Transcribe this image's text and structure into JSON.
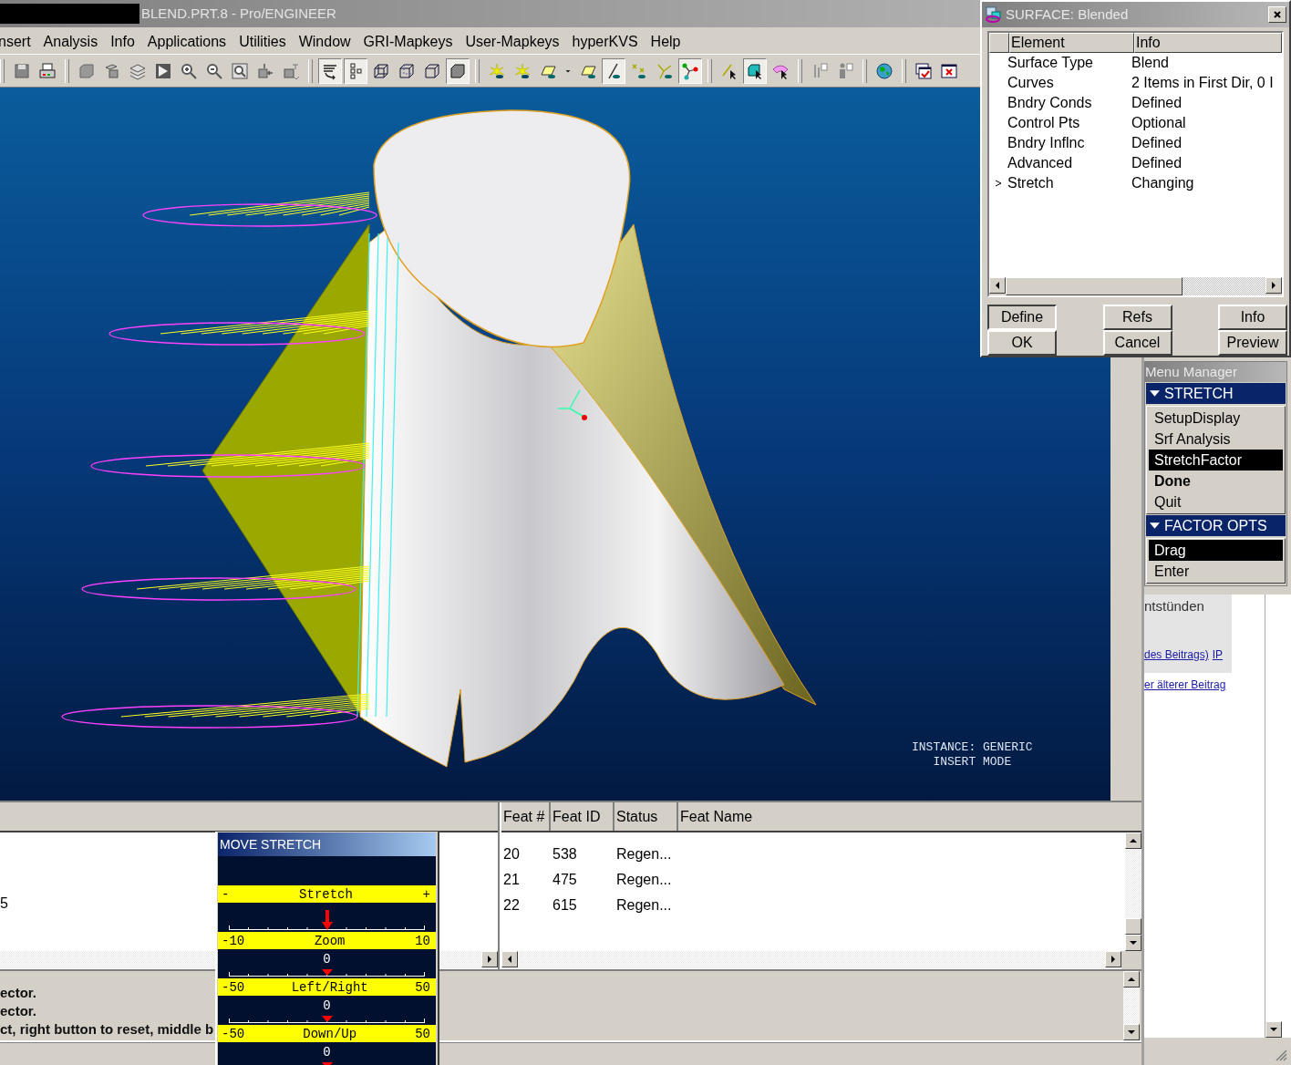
{
  "window": {
    "title": "BLEND.PRT.8 - Pro/ENGINEER"
  },
  "menu_bar": [
    "nsert",
    "Analysis",
    "Info",
    "Applications",
    "Utilities",
    "Window",
    "GRI-Mapkeys",
    "User-Mapkeys",
    "hyperKVS",
    "Help"
  ],
  "toolbar": [
    [
      {
        "kind": "disk",
        "on": false
      },
      {
        "kind": "printer",
        "on": false
      }
    ],
    [
      {
        "kind": "cube",
        "on": false
      },
      {
        "kind": "cubes",
        "on": false
      },
      {
        "kind": "layers",
        "on": false
      },
      {
        "kind": "play",
        "on": false
      },
      {
        "kind": "zoomin",
        "on": false
      },
      {
        "kind": "zoomout",
        "on": false
      },
      {
        "kind": "refit",
        "on": false
      },
      {
        "kind": "orient",
        "on": false
      },
      {
        "kind": "label",
        "on": false
      }
    ],
    [
      {
        "kind": "lines",
        "on": true
      },
      {
        "kind": "tree",
        "on": true
      },
      {
        "kind": "wireframe",
        "on": false
      },
      {
        "kind": "hidden",
        "on": false
      },
      {
        "kind": "outline",
        "on": false
      },
      {
        "kind": "shaded",
        "on": true
      }
    ],
    [
      {
        "kind": "spark",
        "on": false
      },
      {
        "kind": "spark",
        "on": false
      },
      {
        "kind": "plane",
        "on": false
      },
      {
        "kind": "caret",
        "on": false
      },
      {
        "kind": "plane",
        "on": false
      },
      {
        "kind": "axis",
        "on": true
      },
      {
        "kind": "points",
        "on": false
      },
      {
        "kind": "csys",
        "on": false
      },
      {
        "kind": "nodes",
        "on": true
      }
    ],
    [
      {
        "kind": "pick",
        "on": false
      },
      {
        "kind": "boxpick",
        "on": true
      },
      {
        "kind": "surfpick",
        "on": false
      }
    ],
    [
      {
        "kind": "measure",
        "on": false
      },
      {
        "kind": "person",
        "on": false
      }
    ],
    [
      {
        "kind": "globe",
        "on": false
      }
    ],
    [
      {
        "kind": "wincheck",
        "on": false
      },
      {
        "kind": "winclose",
        "on": false
      }
    ]
  ],
  "viewport": {
    "status_lines": [
      "INSTANCE: GENERIC",
      "INSERT MODE"
    ]
  },
  "left_panel": {
    "items": [
      "5"
    ]
  },
  "model_tree": {
    "columns": [
      "Feat #",
      "Feat ID",
      "Status",
      "Feat Name"
    ],
    "rows": [
      [
        "20",
        "538",
        "Regen..."
      ],
      [
        "21",
        "475",
        "Regen..."
      ],
      [
        "22",
        "615",
        "Regen..."
      ]
    ]
  },
  "messages": [
    "ector.",
    "ector.",
    "ct, right button to reset, middle b"
  ],
  "surface_dialog": {
    "title": "SURFACE: Blended",
    "columns": [
      "Element",
      "Info"
    ],
    "rows": [
      {
        "element": "Surface Type",
        "info": "Blend",
        "selected": false
      },
      {
        "element": "Curves",
        "info": "2 Items in First Dir, 0 I",
        "selected": false
      },
      {
        "element": "Bndry Conds",
        "info": "Defined",
        "selected": false
      },
      {
        "element": "Control Pts",
        "info": "Optional",
        "selected": false
      },
      {
        "element": "Bndry Inflnc",
        "info": "Defined",
        "selected": false
      },
      {
        "element": "Advanced",
        "info": "Defined",
        "selected": false
      },
      {
        "element": "Stretch",
        "info": "Changing",
        "selected": true
      }
    ],
    "buttons": [
      "Define",
      "Refs",
      "Info",
      "OK",
      "Cancel",
      "Preview"
    ]
  },
  "menu_manager": {
    "title": "Menu Manager",
    "sections": [
      {
        "title": "STRETCH",
        "items": [
          {
            "label": "SetupDisplay",
            "selected": false,
            "bold": false
          },
          {
            "label": "Srf Analysis",
            "selected": false,
            "bold": false
          },
          {
            "label": "StretchFactor",
            "selected": true,
            "bold": false
          },
          {
            "label": "Done",
            "selected": false,
            "bold": true
          },
          {
            "label": "Quit",
            "selected": false,
            "bold": false
          }
        ]
      },
      {
        "title": "FACTOR OPTS",
        "items": [
          {
            "label": "Drag",
            "selected": true,
            "bold": false
          },
          {
            "label": "Enter",
            "selected": false,
            "bold": false
          }
        ]
      }
    ]
  },
  "move_stretch": {
    "title": "MOVE STRETCH",
    "sliders": [
      {
        "kind": "arrow",
        "min": "-",
        "label": "Stretch",
        "max": "+",
        "level": 0.5
      },
      {
        "kind": "value",
        "min": "-10",
        "label": "Zoom",
        "max": "10",
        "value": "0",
        "level": 0.5
      },
      {
        "kind": "value",
        "min": "-50",
        "label": "Left/Right",
        "max": "50",
        "value": "0",
        "level": 0.5
      },
      {
        "kind": "value",
        "min": "-50",
        "label": "Down/Up",
        "max": "50",
        "value": "0",
        "level": 0.5
      }
    ]
  },
  "browser_background": {
    "text": "ntstünden",
    "links": [
      "des Beitrags)",
      "IP"
    ],
    "link_below": "er älterer Beitrag"
  }
}
